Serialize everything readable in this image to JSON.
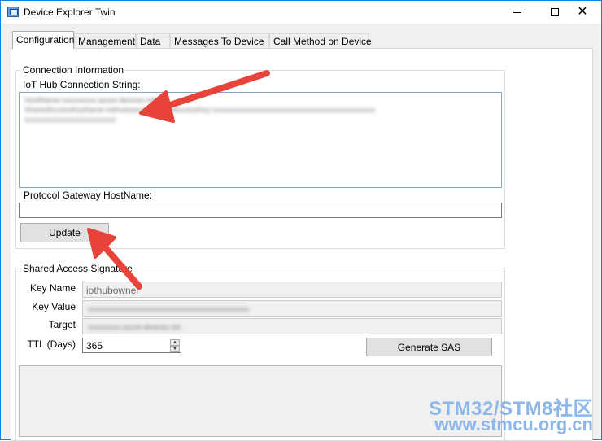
{
  "window": {
    "title": "Device Explorer Twin",
    "icon": "app-window-icon",
    "controls": {
      "minimize": "minimize-icon",
      "maximize": "maximize-icon",
      "close": "close-icon"
    }
  },
  "tabs": [
    {
      "label": "Configuration",
      "active": true
    },
    {
      "label": "Management"
    },
    {
      "label": "Data"
    },
    {
      "label": "Messages To Device"
    },
    {
      "label": "Call Method on Device"
    }
  ],
  "connection": {
    "group_label": "Connection Information",
    "conn_string_label": "IoT Hub Connection String:",
    "conn_string_lines": [
      "HostName=xxxxxxxxx.azure-devices.net;",
      "SharedAccessKeyName=iothubowner;SharedAccessKey=xxxxxxxxxxxxxxxxxxxxxxxxxxxxxxxxxxxxxxxxxxxx",
      "xxxxxxxxxxxxxxxxxxxxxxxxx"
    ],
    "gateway_label": "Protocol Gateway HostName:",
    "gateway_value": "",
    "update_button": "Update"
  },
  "sas": {
    "group_label": "Shared Access Signature",
    "key_name_label": "Key Name",
    "key_name_value": "iothubowner",
    "key_value_label": "Key Value",
    "key_value_value": "xxxxxxxxxxxxxxxxxxxxxxxxxxxxxxxxxxxxxxxxxxxx",
    "target_label": "Target",
    "target_value": "xxxxxxxxx.azure-devices.net",
    "ttl_label": "TTL (Days)",
    "ttl_value": "365",
    "generate_button": "Generate SAS"
  },
  "watermark": {
    "line1": "STM32/STM8社区",
    "line2": "www.stmcu.org.cn"
  },
  "colors": {
    "arrow": "#e8433a",
    "accent_border": "#1883d7",
    "watermark": "#8cb7e8"
  }
}
